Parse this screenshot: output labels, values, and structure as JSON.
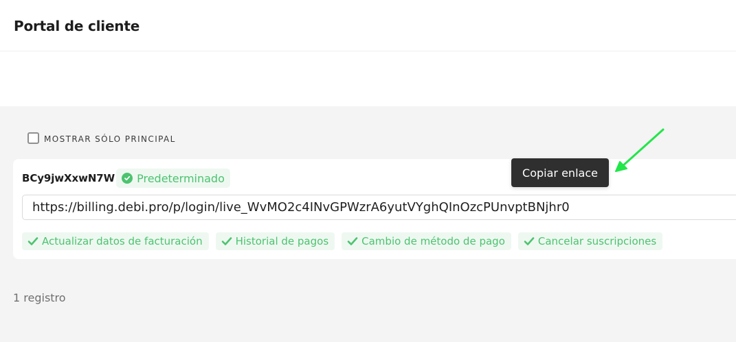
{
  "header": {
    "title": "Portal de cliente"
  },
  "filter": {
    "label": "MOSTRAR SÓLO PRINCIPAL",
    "checked": false
  },
  "portal": {
    "id": "BCy9jwXxwN7W",
    "badge": "Predeterminado",
    "url": "https://billing.debi.pro/p/login/live_WvMO2c4INvGPWzrA6yutVYghQInOzcPUnvptBNjhr0",
    "features": [
      "Actualizar datos de facturación",
      "Historial de pagos",
      "Cambio de método de pago",
      "Cancelar suscripciones"
    ]
  },
  "tooltip": {
    "text": "Copiar enlace"
  },
  "footer": {
    "count": "1 registro"
  },
  "colors": {
    "accent_green": "#4cc36f",
    "badge_bg": "#eef8f1",
    "content_bg": "#f4f4f4",
    "tooltip_bg": "#2f2f2f",
    "annotation_arrow": "#22e64a"
  }
}
